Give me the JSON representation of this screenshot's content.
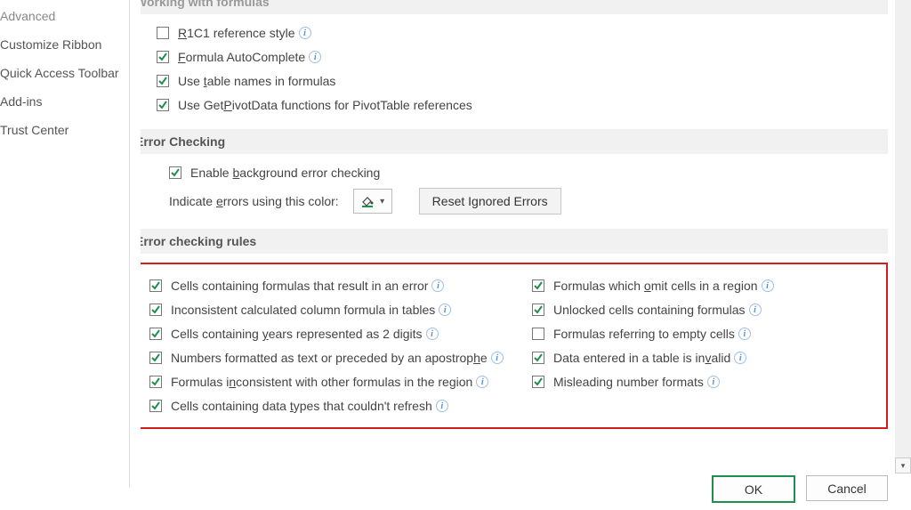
{
  "sidebar": {
    "items": [
      {
        "label": "Advanced"
      },
      {
        "label": "Customize Ribbon"
      },
      {
        "label": "Quick Access Toolbar"
      },
      {
        "label": "Add-ins"
      },
      {
        "label": "Trust Center"
      }
    ]
  },
  "sections": {
    "formulas_title": "Working with formulas",
    "error_checking_title": "Error Checking",
    "rules_title": "Error checking rules"
  },
  "formulas": {
    "r1c1_pre": "",
    "r1c1_u": "R",
    "r1c1_post": "1C1 reference style",
    "autoc_pre": "",
    "autoc_u": "F",
    "autoc_post": "ormula AutoComplete",
    "tnames_pre": "Use ",
    "tnames_u": "t",
    "tnames_post": "able names in formulas",
    "getpivot_pre": "Use Get",
    "getpivot_u": "P",
    "getpivot_post": "ivotData functions for PivotTable references"
  },
  "errchk": {
    "bg_pre": "Enable ",
    "bg_u": "b",
    "bg_post": "ackground error checking",
    "color_pre": "Indicate ",
    "color_u": "e",
    "color_post": "rrors using this color:",
    "reset_pre": "Reset I",
    "reset_u": "g",
    "reset_post": "nored Errors"
  },
  "rules": {
    "l1_pre": "Cells containing formulas that result in an error",
    "l2": "Inconsistent calculated column formula in tables",
    "l3_pre": "Cells containing ",
    "l3_u": "y",
    "l3_post": "ears represented as 2 digits",
    "l4_pre": "Numbers formatted as text or preceded by an apostrop",
    "l4_u": "h",
    "l4_post": "e",
    "l5_pre": "Formulas i",
    "l5_u": "n",
    "l5_post": "consistent with other formulas in the region",
    "l6_pre": "Cells containing data ",
    "l6_u": "t",
    "l6_post": "ypes that couldn't refresh",
    "r1_pre": "Formulas which ",
    "r1_u": "o",
    "r1_post": "mit cells in a region",
    "r2": "Unlocked cells containing formulas",
    "r3": "Formulas referring to empty cells",
    "r4_pre": "Data entered in a table is in",
    "r4_u": "v",
    "r4_post": "alid",
    "r5": "Misleading number formats"
  },
  "buttons": {
    "ok": "OK",
    "cancel": "Cancel"
  },
  "icons": {
    "color_accent": "#1f8f4e"
  }
}
